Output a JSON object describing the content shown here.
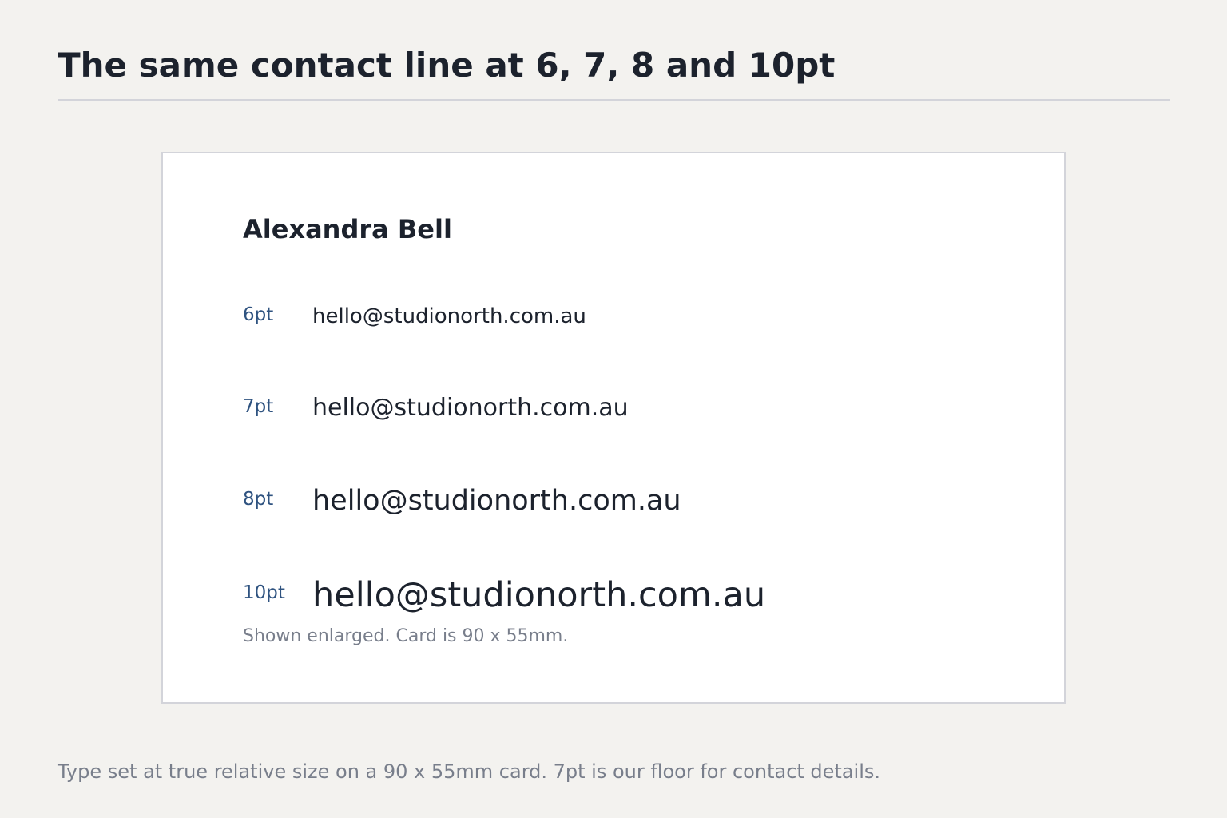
{
  "page": {
    "title": "The same contact line at 6, 7, 8 and 10pt",
    "caption": "Type set at true relative size on a 90 x 55mm card. 7pt is our floor for contact details."
  },
  "card": {
    "name": "Alexandra Bell",
    "rows": [
      {
        "size_label": "6pt",
        "point_size": 6,
        "sample": "hello@studionorth.com.au"
      },
      {
        "size_label": "7pt",
        "point_size": 7,
        "sample": "hello@studionorth.com.au"
      },
      {
        "size_label": "8pt",
        "point_size": 8,
        "sample": "hello@studionorth.com.au"
      },
      {
        "size_label": "10pt",
        "point_size": 10,
        "sample": "hello@studionorth.com.au"
      }
    ],
    "note": "Shown enlarged. Card is 90 x 55mm."
  },
  "colors": {
    "background": "#f3f2ef",
    "card": "#ffffff",
    "text": "#1c222d",
    "size_label": "#2f5380",
    "muted": "#787e8b",
    "rule": "#d3d4da"
  }
}
